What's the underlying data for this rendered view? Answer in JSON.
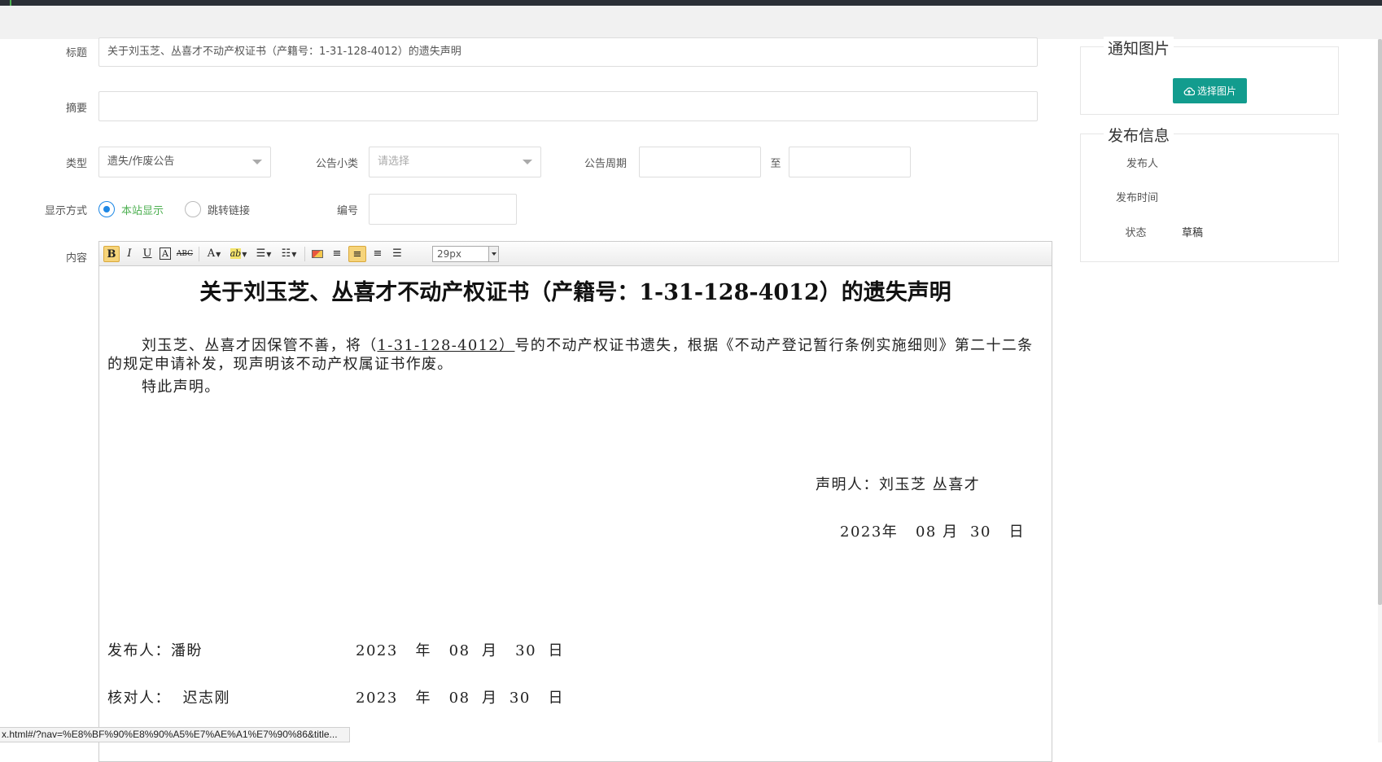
{
  "form": {
    "title_label": "标题",
    "title_value": "关于刘玉芝、丛喜才不动产权证书（产籍号：1-31-128-4012）的遗失声明",
    "summary_label": "摘要",
    "summary_value": "",
    "type_label": "类型",
    "type_value": "遗失/作废公告",
    "subcategory_label": "公告小类",
    "subcategory_placeholder": "请选择",
    "period_label": "公告周期",
    "period_start": "",
    "period_to": "至",
    "period_end": "",
    "display_label": "显示方式",
    "display_options": [
      "本站显示",
      "跳转链接"
    ],
    "display_selected": "本站显示",
    "number_label": "编号",
    "number_value": "",
    "content_label": "内容"
  },
  "toolbar": {
    "bold": "B",
    "italic": "I",
    "underline": "U",
    "font_color": "A",
    "strike": "ABC",
    "text_color": "A",
    "highlight": "ab",
    "font_size": "29px"
  },
  "document": {
    "title": "关于刘玉芝、丛喜才不动产权证书（产籍号：1-31-128-4012）的遗失声明",
    "para1_before": "刘玉芝、丛喜才因保管不善，将（",
    "para1_underlined": "1-31-128-4012）",
    "para1_after": "号的不动产权证书遗失，根据《不动产登记暂行条例实施细则》第二十二条的规定申请补发，现声明该不动产权属证书作废。",
    "para2": "特此声明。",
    "declarant": "声明人：刘玉芝 丛喜才",
    "decl_date": "2023年   08 月  30   日",
    "publisher_line": "发布人：潘盼",
    "publisher_date": "2023   年   08  月   30  日",
    "checker_line": "核对人：  迟志刚",
    "checker_date": "2023   年   08  月  30   日"
  },
  "sidebar": {
    "image_panel_title": "通知图片",
    "upload_button": "选择图片",
    "publish_panel_title": "发布信息",
    "publisher_label": "发布人",
    "publisher_value": "",
    "publish_time_label": "发布时间",
    "publish_time_value": "",
    "status_label": "状态",
    "status_value": "草稿"
  },
  "statusbar": {
    "url": "x.html#/?nav=%E8%BF%90%E8%90%A5%E7%AE%A1%E7%90%86&title..."
  },
  "colors": {
    "accent_green": "#4caf50",
    "radio_blue": "#1e88e5",
    "button_teal": "#129c8e"
  }
}
